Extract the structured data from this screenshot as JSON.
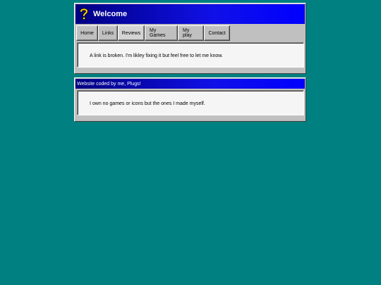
{
  "window_main": {
    "title": "Welcome",
    "icon": "question-mark-icon",
    "nav": [
      {
        "label": "Home"
      },
      {
        "label": "Links"
      },
      {
        "label": "Reviews"
      },
      {
        "label": "My Games"
      },
      {
        "label": "My play"
      },
      {
        "label": "Contact"
      }
    ],
    "message": "A link is broken. I'm likley fixing it but feel free to let me know."
  },
  "window_footer": {
    "title": "Website coded by me, Plugs!",
    "message": "I own no games or icons but the ones I made myself."
  },
  "colors": {
    "desktop": "#008080",
    "titlebar_start": "#000080",
    "titlebar_end": "#0000ff",
    "window_face": "#c0c0c0",
    "panel": "#f5f5f5",
    "icon_yellow": "#ffd700"
  }
}
